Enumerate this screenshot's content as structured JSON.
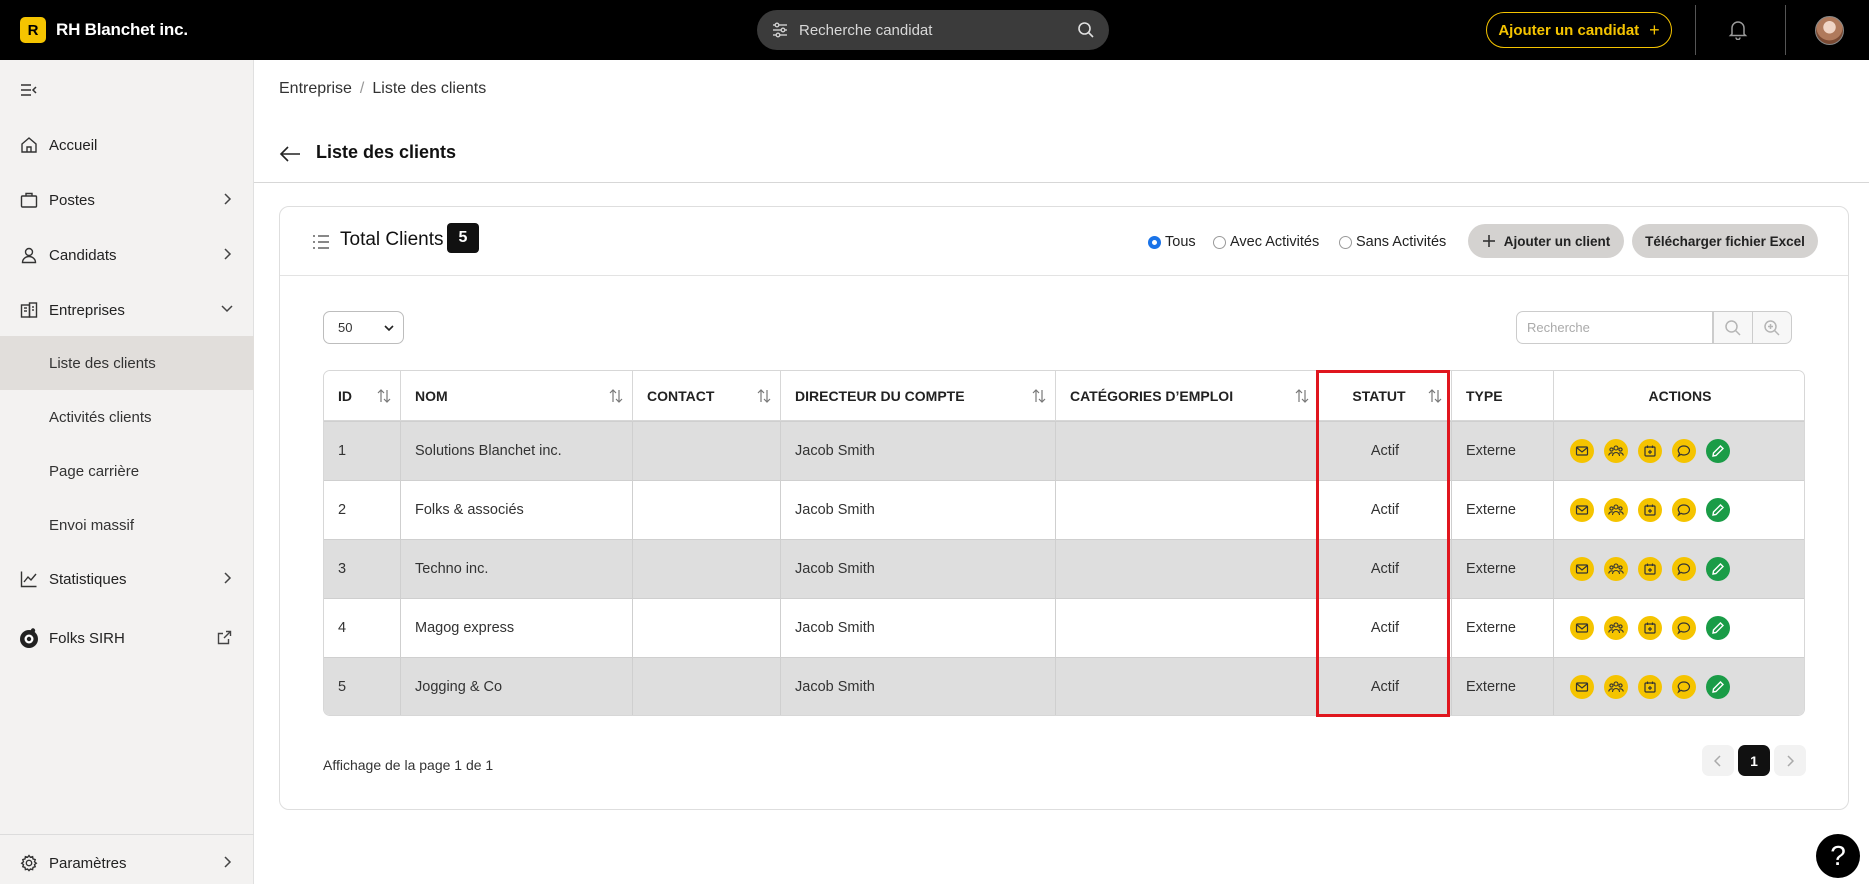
{
  "brand": {
    "logo_letter": "R",
    "name": "RH Blanchet inc.",
    "accent": "#f5c400"
  },
  "topbar": {
    "search_placeholder": "Recherche candidat",
    "add_candidate": "Ajouter un candidat",
    "add_icon": "+"
  },
  "sidebar": {
    "items": [
      {
        "label": "Accueil",
        "icon": "home-icon"
      },
      {
        "label": "Postes",
        "icon": "briefcase-icon"
      },
      {
        "label": "Candidats",
        "icon": "user-icon"
      },
      {
        "label": "Entreprises",
        "icon": "building-icon"
      },
      {
        "label": "Statistiques",
        "icon": "chart-icon"
      },
      {
        "label": "Folks SIRH",
        "icon": "folks-logo-icon"
      },
      {
        "label": "Paramètres",
        "icon": "gear-icon"
      }
    ],
    "subitems": [
      {
        "label": "Liste des clients",
        "active": true
      },
      {
        "label": "Activités clients"
      },
      {
        "label": "Page carrière"
      },
      {
        "label": "Envoi massif"
      }
    ]
  },
  "breadcrumb": {
    "parent": "Entreprise",
    "separator": "/",
    "current": "Liste des clients"
  },
  "page": {
    "title": "Liste des clients"
  },
  "card": {
    "total_label": "Total Clients",
    "total_count": "5",
    "filters": {
      "all": "Tous",
      "with": "Avec Activités",
      "without": "Sans Activités",
      "selected": "Tous"
    },
    "add_client": "Ajouter un client",
    "download_excel": "Télécharger fichier Excel"
  },
  "table": {
    "per_page": "50",
    "search_placeholder": "Recherche",
    "columns": [
      "ID",
      "NOM",
      "CONTACT",
      "DIRECTEUR DU COMPTE",
      "CATÉGORIES D’EMPLOI",
      "STATUT",
      "TYPE",
      "ACTIONS"
    ],
    "rows": [
      {
        "id": "1",
        "nom": "Solutions Blanchet inc.",
        "contact": "",
        "directeur": "Jacob Smith",
        "categories": "",
        "statut": "Actif",
        "type": "Externe"
      },
      {
        "id": "2",
        "nom": "Folks & associés",
        "contact": "",
        "directeur": "Jacob Smith",
        "categories": "",
        "statut": "Actif",
        "type": "Externe"
      },
      {
        "id": "3",
        "nom": "Techno inc.",
        "contact": "",
        "directeur": "Jacob Smith",
        "categories": "",
        "statut": "Actif",
        "type": "Externe"
      },
      {
        "id": "4",
        "nom": "Magog express",
        "contact": "",
        "directeur": "Jacob Smith",
        "categories": "",
        "statut": "Actif",
        "type": "Externe"
      },
      {
        "id": "5",
        "nom": "Jogging & Co",
        "contact": "",
        "directeur": "Jacob Smith",
        "categories": "",
        "statut": "Actif",
        "type": "Externe"
      }
    ],
    "action_icons": [
      "mail-icon",
      "team-icon",
      "calendar-icon",
      "comment-icon",
      "edit-icon"
    ]
  },
  "pagination": {
    "info": "Affichage de la page 1 de 1",
    "current": "1"
  },
  "help": {
    "label": "?"
  },
  "colors": {
    "highlight": "#e0161e",
    "edit_action": "#1a9c47",
    "selected_radio": "#1a73e8"
  }
}
